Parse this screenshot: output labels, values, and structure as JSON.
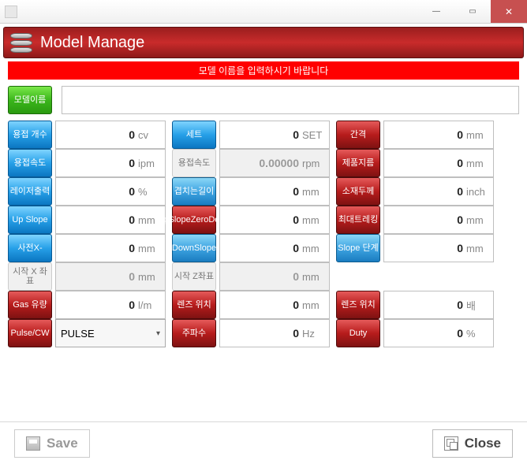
{
  "titlebar": {
    "title": ""
  },
  "header": {
    "title": "Model Manage"
  },
  "notice": "모델 이름을 입력하시기 바랍니다",
  "row_model": {
    "label": "모델이름",
    "value": ""
  },
  "rows": [
    [
      {
        "label": "용접 개수",
        "value": "0",
        "unit": "cv",
        "style": "blue"
      },
      {
        "label": "세트",
        "value": "0",
        "unit": "SET",
        "style": "blue"
      },
      {
        "label": "간격",
        "value": "0",
        "unit": "mm",
        "style": "red"
      }
    ],
    [
      {
        "label": "용접속도",
        "value": "0",
        "unit": "ipm",
        "style": "blue"
      },
      {
        "label": "용접속도",
        "value": "0.00000",
        "unit": "rpm",
        "style": "gray",
        "disabled": true
      },
      {
        "label": "제품지름",
        "value": "0",
        "unit": "mm",
        "style": "red"
      }
    ],
    [
      {
        "label": "레이저출력",
        "value": "0",
        "unit": "%",
        "style": "blue"
      },
      {
        "label": "겹치는길이",
        "value": "0",
        "unit": "mm",
        "style": "blue2"
      },
      {
        "label": "소재두께",
        "value": "0",
        "unit": "inch",
        "style": "red"
      }
    ],
    [
      {
        "label": "Up Slope",
        "value": "0",
        "unit": "mm",
        "style": "blue"
      },
      {
        "label": "UpSlopeZeroDelay",
        "value": "0",
        "unit": "mm",
        "style": "red"
      },
      {
        "label": "최대트레킹",
        "value": "0",
        "unit": "mm",
        "style": "red"
      }
    ],
    [
      {
        "label": "사전X-",
        "value": "0",
        "unit": "mm",
        "style": "blue"
      },
      {
        "label": "DownSlope",
        "value": "0",
        "unit": "mm",
        "style": "blue2"
      },
      {
        "label": "Slope 단계",
        "value": "0",
        "unit": "mm",
        "style": "blue2"
      }
    ],
    [
      {
        "label": "시작 X 좌표",
        "value": "0",
        "unit": "mm",
        "style": "gray",
        "disabled": true
      },
      {
        "label": "시작 Z좌표",
        "value": "0",
        "unit": "mm",
        "style": "gray",
        "disabled": true
      },
      null
    ],
    [
      {
        "label": "Gas 유량",
        "value": "0",
        "unit": "l/m",
        "style": "red"
      },
      {
        "label": "렌즈 위치",
        "value": "0",
        "unit": "mm",
        "style": "red"
      },
      {
        "label": "렌즈 위치",
        "value": "0",
        "unit": "배",
        "style": "red"
      }
    ],
    [
      {
        "label": "Pulse/CW",
        "select": "PULSE",
        "style": "red"
      },
      {
        "label": "주파수",
        "value": "0",
        "unit": "Hz",
        "style": "red"
      },
      {
        "label": "Duty",
        "value": "0",
        "unit": "%",
        "style": "red"
      }
    ]
  ],
  "footer": {
    "save": "Save",
    "close": "Close"
  }
}
